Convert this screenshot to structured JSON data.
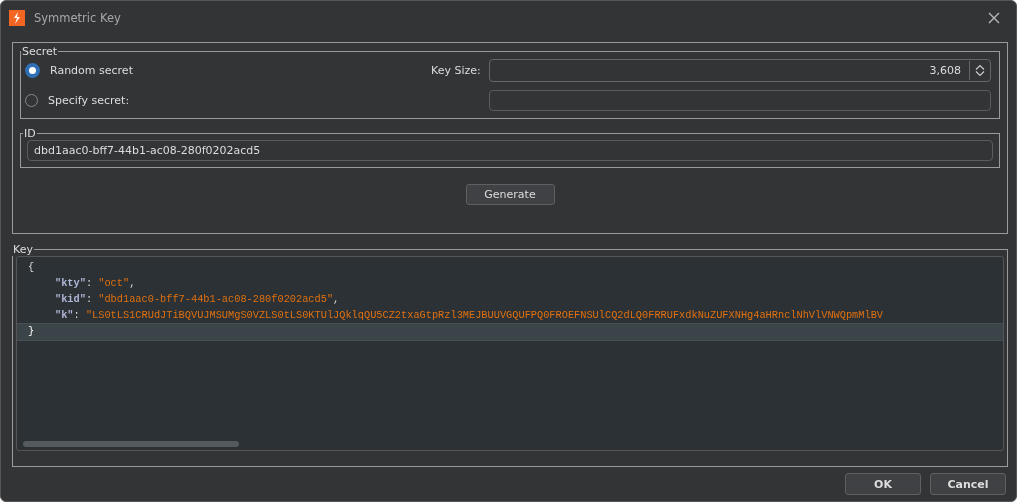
{
  "window": {
    "title": "Symmetric Key"
  },
  "secret": {
    "legend": "Secret",
    "options": [
      {
        "label": "Random secret",
        "selected": true
      },
      {
        "label": "Specify secret:",
        "selected": false
      }
    ],
    "key_size_label": "Key Size:",
    "key_size_value": "3,608"
  },
  "id": {
    "legend": "ID",
    "value": "dbd1aac0-bff7-44b1-ac08-280f0202acd5"
  },
  "generate_button": "Generate",
  "key": {
    "legend": "Key",
    "lines": [
      {
        "kind": "brace",
        "text": "{",
        "current": false
      },
      {
        "kind": "property",
        "key": "\"kty\"",
        "sep": ":",
        "value": "\"oct\"",
        "end": ",",
        "current": false
      },
      {
        "kind": "property",
        "key": "\"kid\"",
        "sep": ":",
        "value": "\"dbd1aac0-bff7-44b1-ac08-280f0202acd5\"",
        "end": ",",
        "current": false
      },
      {
        "kind": "property",
        "key": "\"k\"",
        "sep": ":",
        "value": "\"LS0tLS1CRUdJTiBQVUJMSUMgS0VZLS0tLS0KTUlJQklqQU5CZ2txaGtpRzl3MEJBUUVGQUFPQ0FROEFNSUlCQ2dLQ0FRRUFxdkNuZUFXNHg4aHRnclNhVlVNWQpmMlBV",
        "current": false
      },
      {
        "kind": "brace",
        "text": "}",
        "current": true
      }
    ]
  },
  "buttons": [
    "OK",
    "Cancel"
  ]
}
